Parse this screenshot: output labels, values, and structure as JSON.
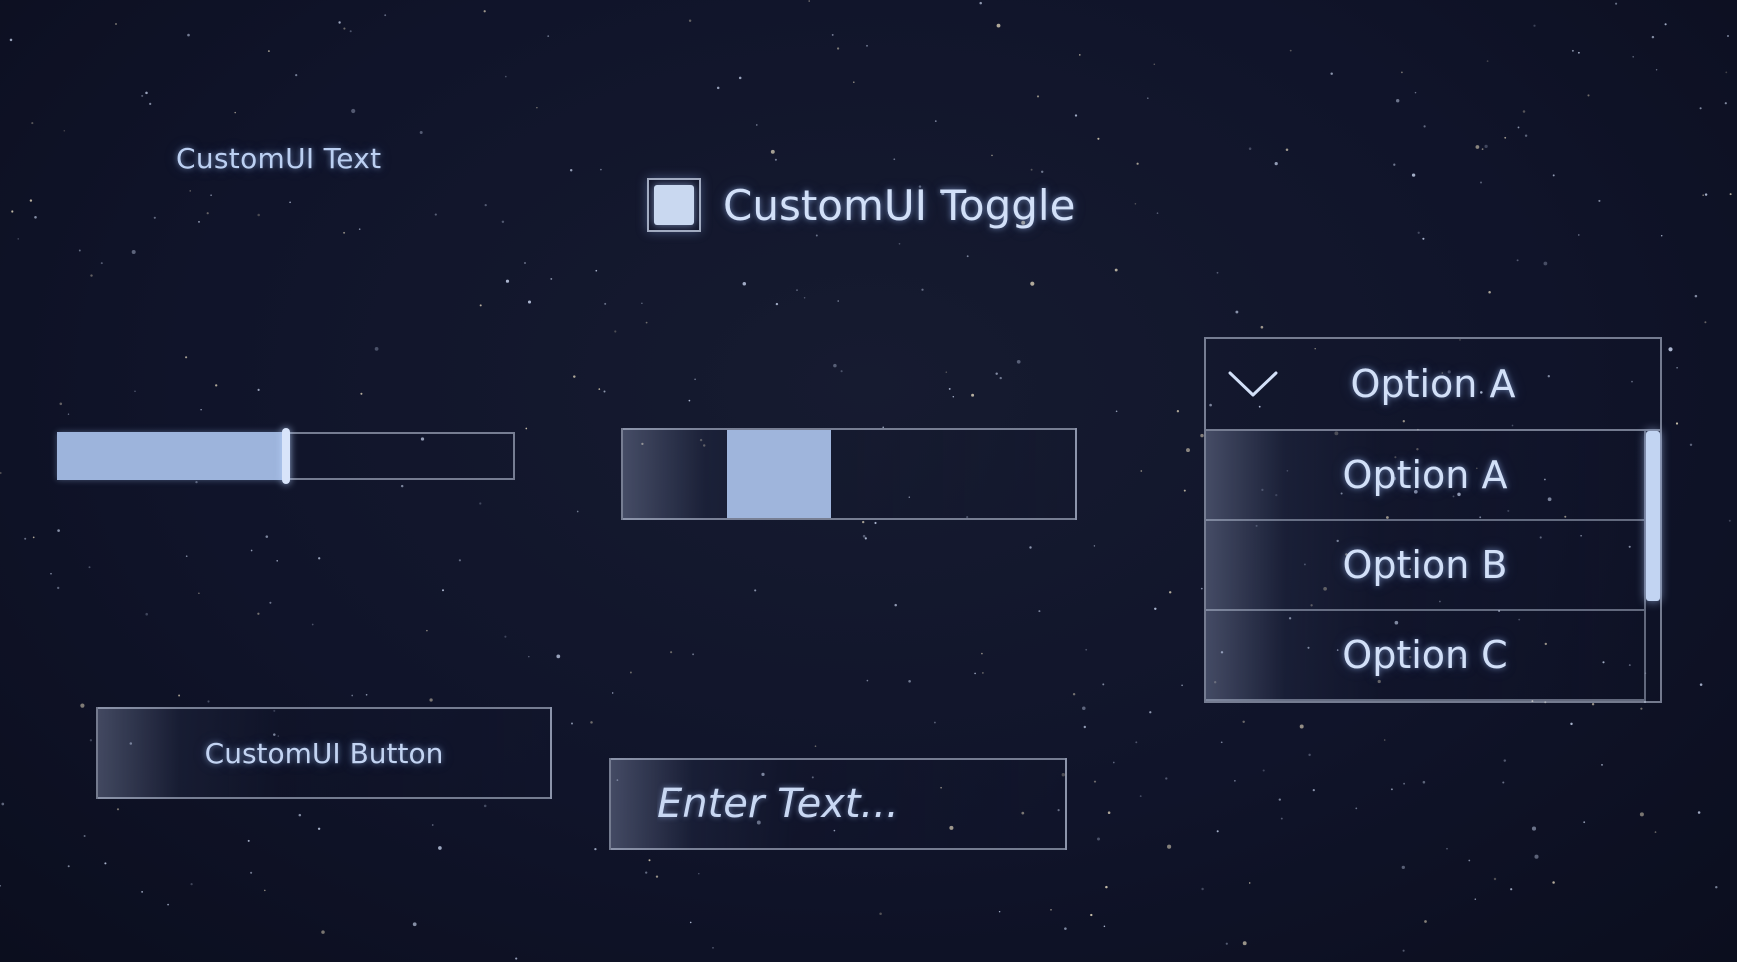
{
  "text_label": "CustomUI Text",
  "toggle": {
    "label": "CustomUI Toggle",
    "checked": true
  },
  "slider": {
    "value": 0.5
  },
  "scrollbar": {
    "position": 0.3,
    "size": 0.23
  },
  "button": {
    "label": "CustomUI Button"
  },
  "input": {
    "placeholder": "Enter Text...",
    "value": ""
  },
  "dropdown": {
    "selected": "Option A",
    "options": [
      "Option A",
      "Option B",
      "Option C"
    ],
    "scroll_position": 0
  },
  "colors": {
    "accent": "#9db4dc",
    "text": "#d2e0f8",
    "background": "#10142a",
    "border": "#c8d2e6"
  },
  "icons": {
    "dropdown_arrow": "chevron-down-icon"
  }
}
